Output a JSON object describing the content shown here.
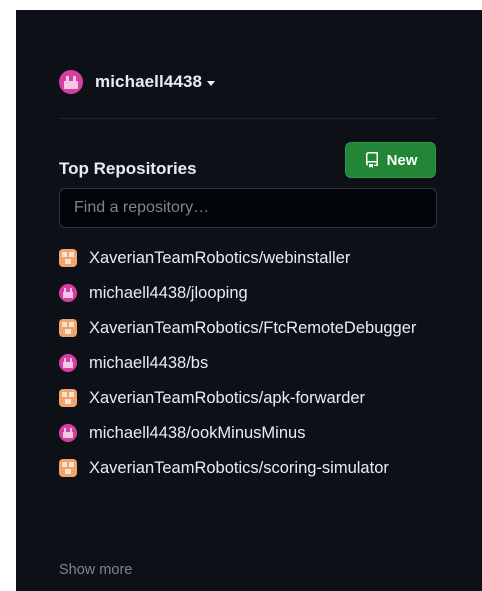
{
  "user": {
    "name": "michaell4438"
  },
  "top_repositories": {
    "title": "Top Repositories",
    "new_button_label": "New",
    "search_placeholder": "Find a repository…",
    "repos": [
      {
        "name": "XaverianTeamRobotics/webinstaller",
        "owner_type": "org"
      },
      {
        "name": "michaell4438/jlooping",
        "owner_type": "user"
      },
      {
        "name": "XaverianTeamRobotics/FtcRemoteDebugger",
        "owner_type": "org"
      },
      {
        "name": "michaell4438/bs",
        "owner_type": "user"
      },
      {
        "name": "XaverianTeamRobotics/apk-forwarder",
        "owner_type": "org"
      },
      {
        "name": "michaell4438/ookMinusMinus",
        "owner_type": "user"
      },
      {
        "name": "XaverianTeamRobotics/scoring-simulator",
        "owner_type": "org"
      }
    ],
    "show_more_label": "Show more"
  },
  "colors": {
    "background": "#0d1117",
    "text": "#e6edf3",
    "muted": "#7d8590",
    "accent_green": "#238636",
    "user_avatar": "#d63fa0",
    "org_avatar": "#f0a36c"
  }
}
